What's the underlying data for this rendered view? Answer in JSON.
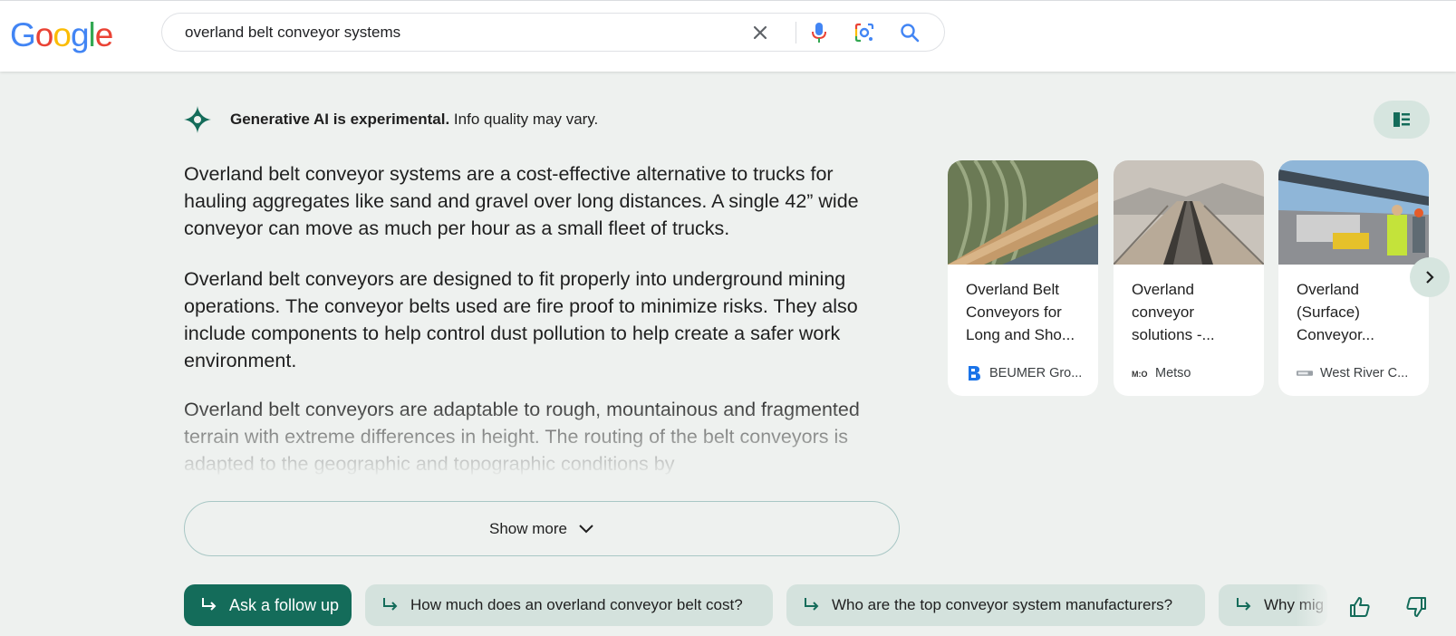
{
  "header": {
    "logo_letters": [
      "G",
      "o",
      "o",
      "g",
      "l",
      "e"
    ],
    "logo_colors": [
      "#4285F4",
      "#EA4335",
      "#FBBC05",
      "#4285F4",
      "#34A853",
      "#EA4335"
    ],
    "search_query": "overland belt conveyor systems",
    "icons": [
      "close-icon",
      "mic-icon",
      "lens-icon",
      "search-icon"
    ]
  },
  "ai_banner": {
    "bold": "Generative AI is experimental.",
    "rest": " Info quality may vary.",
    "accent": "#146c5a"
  },
  "paragraphs": [
    "Overland belt conveyor systems are a cost-effective alternative to trucks for hauling aggregates like sand and gravel over long distances. A single 42” wide conveyor can move as much per hour as a small fleet of trucks.",
    "Overland belt conveyors are designed to fit properly into underground mining operations. The conveyor belts used are fire proof to minimize risks. They also include components to help control dust pollution to help create a safer work environment.",
    "Overland belt conveyors are adaptable to rough, mountainous and fragmented terrain with extreme differences in height. The routing of the belt conveyors is adapted to the geographic and topographic conditions by"
  ],
  "show_more": "Show more",
  "cards": [
    {
      "title": "Overland Belt Conveyors for Long and Sho...",
      "source": "BEUMER Gro...",
      "favicon": "beumer-b-icon"
    },
    {
      "title": "Overland conveyor solutions -...",
      "source": "Metso",
      "favicon": "metso-icon"
    },
    {
      "title": "Overland (Surface) Conveyor...",
      "source": "West River C...",
      "favicon": "westriver-icon"
    }
  ],
  "followups": {
    "ask": "Ask a follow up",
    "chips": [
      "How much does an overland conveyor belt cost?",
      "Who are the top conveyor system manufacturers?",
      "Why mig"
    ]
  }
}
